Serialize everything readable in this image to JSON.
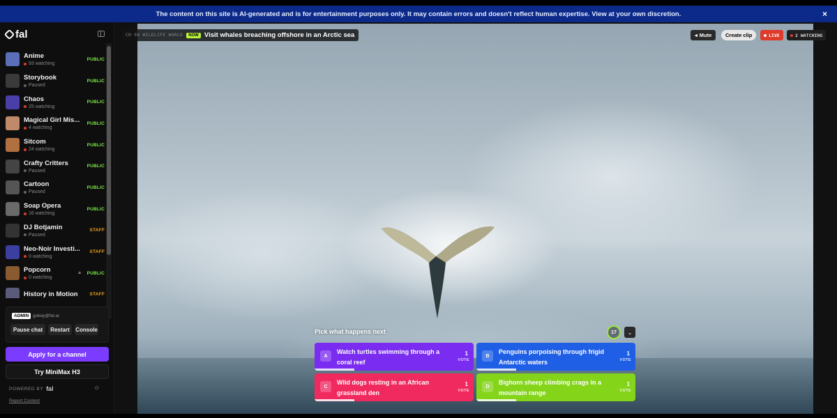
{
  "banner": {
    "text": "The content on this site is AI-generated and is for entertainment purposes only. It may contain errors and doesn't reflect human expertise. View at your own discretion.",
    "close_icon": "×"
  },
  "sidebar": {
    "logo": "fal",
    "channels": [
      {
        "name": "Anime",
        "status": "93 watching",
        "live": true,
        "badge": "PUBLIC",
        "thumb": "#5a6fb8"
      },
      {
        "name": "Storybook",
        "status": "Paused",
        "live": false,
        "badge": "PUBLIC",
        "thumb": "#3a3a3a"
      },
      {
        "name": "Chaos",
        "status": "25 watching",
        "live": true,
        "badge": "PUBLIC",
        "thumb": "#4a3fa8"
      },
      {
        "name": "Magical Girl Mis...",
        "status": "4 watching",
        "live": true,
        "badge": "PUBLIC",
        "thumb": "#c08a6a"
      },
      {
        "name": "Sitcom",
        "status": "24 watching",
        "live": true,
        "badge": "PUBLIC",
        "thumb": "#b07040"
      },
      {
        "name": "Crafty Critters",
        "status": "Paused",
        "live": false,
        "badge": "PUBLIC",
        "thumb": "#444"
      },
      {
        "name": "Cartoon",
        "status": "Paused",
        "live": false,
        "badge": "PUBLIC",
        "thumb": "#555"
      },
      {
        "name": "Soap Opera",
        "status": "16 watching",
        "live": true,
        "badge": "PUBLIC",
        "thumb": "#6a6a6a"
      },
      {
        "name": "DJ Botjamin",
        "status": "Paused",
        "live": false,
        "badge": "STAFF",
        "thumb": "#333"
      },
      {
        "name": "Neo-Noir Investi...",
        "status": "0 watching",
        "live": true,
        "badge": "STAFF",
        "thumb": "#3a3fa0"
      },
      {
        "name": "Popcorn",
        "status": "0 watching",
        "live": true,
        "badge": "PUBLIC",
        "thumb": "#8a5a30",
        "locked": true
      },
      {
        "name": "History in Motion",
        "status": "",
        "live": false,
        "badge": "STAFF",
        "thumb": "#5a5a7a"
      }
    ],
    "admin": {
      "badge": "ADMIN",
      "email": "gokay@fal.ai",
      "pause_label": "Pause chat",
      "restart_label": "Restart",
      "console_label": "Console"
    },
    "apply_label": "Apply for a channel",
    "try_label": "Try MiniMax H3",
    "powered_label": "POWERED BY",
    "powered_logo": "fal",
    "report_label": "Report Content"
  },
  "stage": {
    "channel_label": "CH 08 WILDLIFE WORLD",
    "now_badge": "NOW",
    "now_title": "Visit whales breaching offshore in an Arctic sea",
    "mute_label": "Mute",
    "clip_label": "Create clip",
    "live_label": "LIVE",
    "watching_label": "2 WATCHING"
  },
  "poll": {
    "title": "Pick what happens next",
    "timer": "17",
    "options": [
      {
        "letter": "A",
        "text": "Watch turtles swimming through a coral reef",
        "count": "1",
        "vote": "VOTE",
        "color": "#7a2cf0",
        "progress": 0.25
      },
      {
        "letter": "B",
        "text": "Penguins porpoising through frigid Antarctic waters",
        "count": "1",
        "vote": "VOTE",
        "color": "#1f5fe6",
        "progress": 0.25
      },
      {
        "letter": "C",
        "text": "Wild dogs resting in an African grassland den",
        "count": "1",
        "vote": "VOTE",
        "color": "#f0295f",
        "progress": 0.25
      },
      {
        "letter": "D",
        "text": "Bighorn sheep climbing crags in a mountain range",
        "count": "1",
        "vote": "VOTE",
        "color": "#84d41a",
        "progress": 0.25
      }
    ]
  },
  "colors": {
    "banner_bg": "#0b2a8a",
    "public_badge": "#7ee84a",
    "staff_badge": "#f0a020",
    "live_dot": "#e03a2a",
    "accent": "#7b3cff"
  }
}
